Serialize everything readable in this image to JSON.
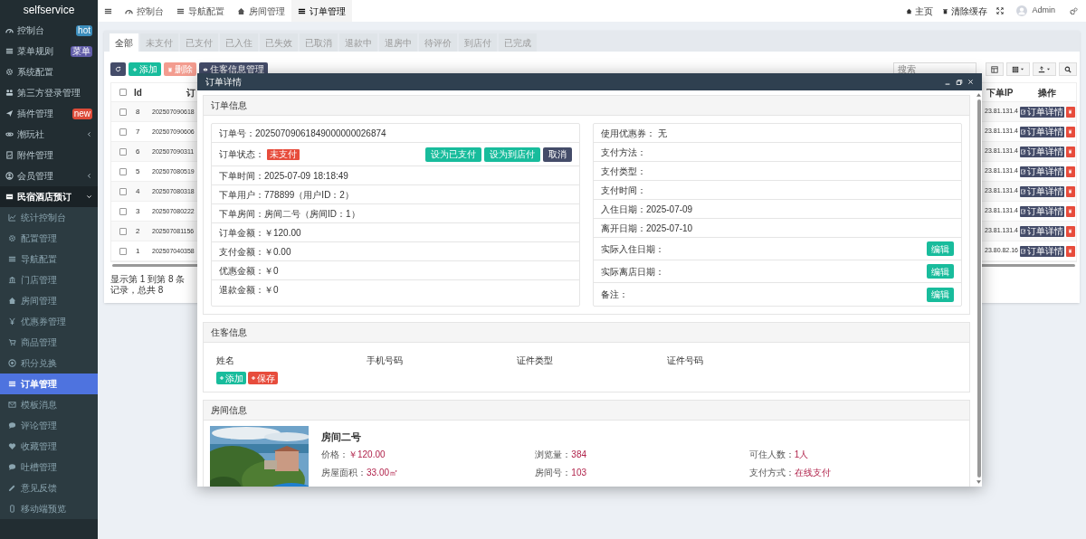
{
  "sidebar": {
    "brand": "selfservice",
    "items": [
      {
        "label": "控制台",
        "badge": {
          "text": "hot",
          "color": "#3c8dbc"
        }
      },
      {
        "label": "菜单规则",
        "badge": {
          "text": "菜单",
          "color": "#605ca8"
        }
      },
      {
        "label": "系统配置"
      },
      {
        "label": "第三方登录管理"
      },
      {
        "label": "插件管理",
        "badge": {
          "text": "new",
          "color": "#dd4b39"
        }
      },
      {
        "label": "潮玩社",
        "expanded": false
      },
      {
        "label": "附件管理"
      },
      {
        "label": "会员管理",
        "expanded": false
      },
      {
        "label": "民宿酒店预订",
        "expanded": true,
        "children": [
          {
            "label": "统计控制台",
            "selected": false
          },
          {
            "label": "配置管理",
            "selected": false
          },
          {
            "label": "导航配置",
            "selected": false
          },
          {
            "label": "门店管理",
            "selected": false
          },
          {
            "label": "房间管理",
            "selected": false
          },
          {
            "label": "优惠券管理",
            "selected": false
          },
          {
            "label": "商品管理",
            "selected": false
          },
          {
            "label": "积分兑换",
            "selected": false
          },
          {
            "label": "订单管理",
            "selected": true
          },
          {
            "label": "模板消息",
            "selected": false
          },
          {
            "label": "评论管理",
            "selected": false
          },
          {
            "label": "收藏管理",
            "selected": false
          },
          {
            "label": "吐槽管理",
            "selected": false
          },
          {
            "label": "意见反馈",
            "selected": false
          },
          {
            "label": "移动端预览",
            "selected": false
          }
        ]
      }
    ]
  },
  "top_bar": {
    "tabs": [
      {
        "label": "控制台",
        "selected": false
      },
      {
        "label": "导航配置",
        "selected": false
      },
      {
        "label": "房间管理",
        "selected": false
      },
      {
        "label": "订单管理",
        "selected": true
      }
    ],
    "links": [
      "主页",
      "清除缓存"
    ],
    "user": "Admin"
  },
  "status_tabs": [
    {
      "label": "全部",
      "selected": true
    },
    {
      "label": "未支付",
      "selected": false
    },
    {
      "label": "已支付",
      "selected": false
    },
    {
      "label": "已入住",
      "selected": false
    },
    {
      "label": "已失效",
      "selected": false
    },
    {
      "label": "已取消",
      "selected": false
    },
    {
      "label": "退款中",
      "selected": false
    },
    {
      "label": "退房中",
      "selected": false
    },
    {
      "label": "待评价",
      "selected": false
    },
    {
      "label": "到店付",
      "selected": false
    },
    {
      "label": "已完成",
      "selected": false
    }
  ],
  "toolbar": {
    "buttons": [
      {
        "kind": "add",
        "label": "添加"
      },
      {
        "kind": "delete",
        "label": "删除"
      },
      {
        "kind": "manage",
        "label": "住客信息管理"
      }
    ],
    "search": {
      "placeholder": "搜索"
    }
  },
  "table": {
    "header_checked": false,
    "columns": [
      "Id",
      "订",
      "下单IP",
      "操作"
    ],
    "rows": [
      {
        "id": "8",
        "order_no": "202507090618",
        "ip": "23.81.131.4",
        "action": "订单详情",
        "checked": false
      },
      {
        "id": "7",
        "order_no": "202507090606",
        "ip": "23.81.131.4",
        "action": "订单详情",
        "checked": false
      },
      {
        "id": "6",
        "order_no": "202507090311",
        "ip": "23.81.131.4",
        "action": "订单详情",
        "checked": false
      },
      {
        "id": "5",
        "order_no": "202507080519",
        "ip": "23.81.131.4",
        "action": "订单详情",
        "checked": false
      },
      {
        "id": "4",
        "order_no": "202507080318",
        "ip": "23.81.131.4",
        "action": "订单详情",
        "checked": false
      },
      {
        "id": "3",
        "order_no": "202507080222",
        "ip": "23.81.131.4",
        "action": "订单详情",
        "checked": false
      },
      {
        "id": "2",
        "order_no": "202507081156",
        "ip": "23.81.131.4",
        "action": "订单详情",
        "checked": false
      },
      {
        "id": "1",
        "order_no": "202507040358",
        "ip": "23.80.82.16",
        "action": "订单详情",
        "checked": false
      }
    ],
    "footer": "显示第 1 到第 8 条记录，总共 8"
  },
  "modal": {
    "title": "订单详情",
    "order_info": {
      "title": "订单信息",
      "left": [
        {
          "kind": "text",
          "text": "订单号：20250709061849000000026874"
        },
        {
          "kind": "status",
          "text": "订单状态：",
          "badge": "未支付",
          "buttons": [
            {
              "kind": "primary",
              "label": "设为已支付"
            },
            {
              "kind": "primary",
              "label": "设为到店付"
            },
            {
              "kind": "dark",
              "label": "取消"
            }
          ]
        },
        {
          "kind": "text",
          "text": "下单时间：2025-07-09 18:18:49"
        },
        {
          "kind": "text",
          "text": "下单用户：778899（用户ID：2）"
        },
        {
          "kind": "text",
          "text": "下单房间：房间二号（房间ID：1）"
        },
        {
          "kind": "text",
          "text": "订单金额：￥120.00"
        },
        {
          "kind": "text",
          "text": "支付金额：￥0.00"
        },
        {
          "kind": "text",
          "text": "优惠金额：￥0"
        },
        {
          "kind": "text",
          "text": "退款金额：￥0"
        }
      ],
      "right": [
        {
          "kind": "text",
          "text": "使用优惠券： 无"
        },
        {
          "kind": "text",
          "text": "支付方法："
        },
        {
          "kind": "text",
          "text": "支付类型："
        },
        {
          "kind": "text",
          "text": "支付时间："
        },
        {
          "kind": "text",
          "text": "入住日期：2025-07-09"
        },
        {
          "kind": "text",
          "text": "离开日期：2025-07-10"
        },
        {
          "kind": "edit",
          "text": "实际入住日期：",
          "button": "编辑"
        },
        {
          "kind": "edit",
          "text": "实际离店日期：",
          "button": "编辑"
        },
        {
          "kind": "edit",
          "text": "备注：",
          "button": "编辑"
        }
      ]
    },
    "guests": {
      "title": "住客信息",
      "columns": [
        "姓名",
        "手机号码",
        "证件类型",
        "证件号码"
      ],
      "buttons": [
        {
          "kind": "add",
          "label": "添加"
        },
        {
          "kind": "save",
          "label": "保存"
        }
      ]
    },
    "room": {
      "title": "房间信息",
      "name": "房间二号",
      "fields": [
        {
          "label": "价格：",
          "value": "￥120.00"
        },
        {
          "label": "浏览量：",
          "value": "384"
        },
        {
          "label": "可住人数：",
          "value": "1人"
        },
        {
          "label": "房屋面积：",
          "value": "33.00㎡"
        },
        {
          "label": "房间号：",
          "value": "103"
        },
        {
          "label": "支付方式：",
          "value": "在线支付"
        }
      ]
    }
  }
}
